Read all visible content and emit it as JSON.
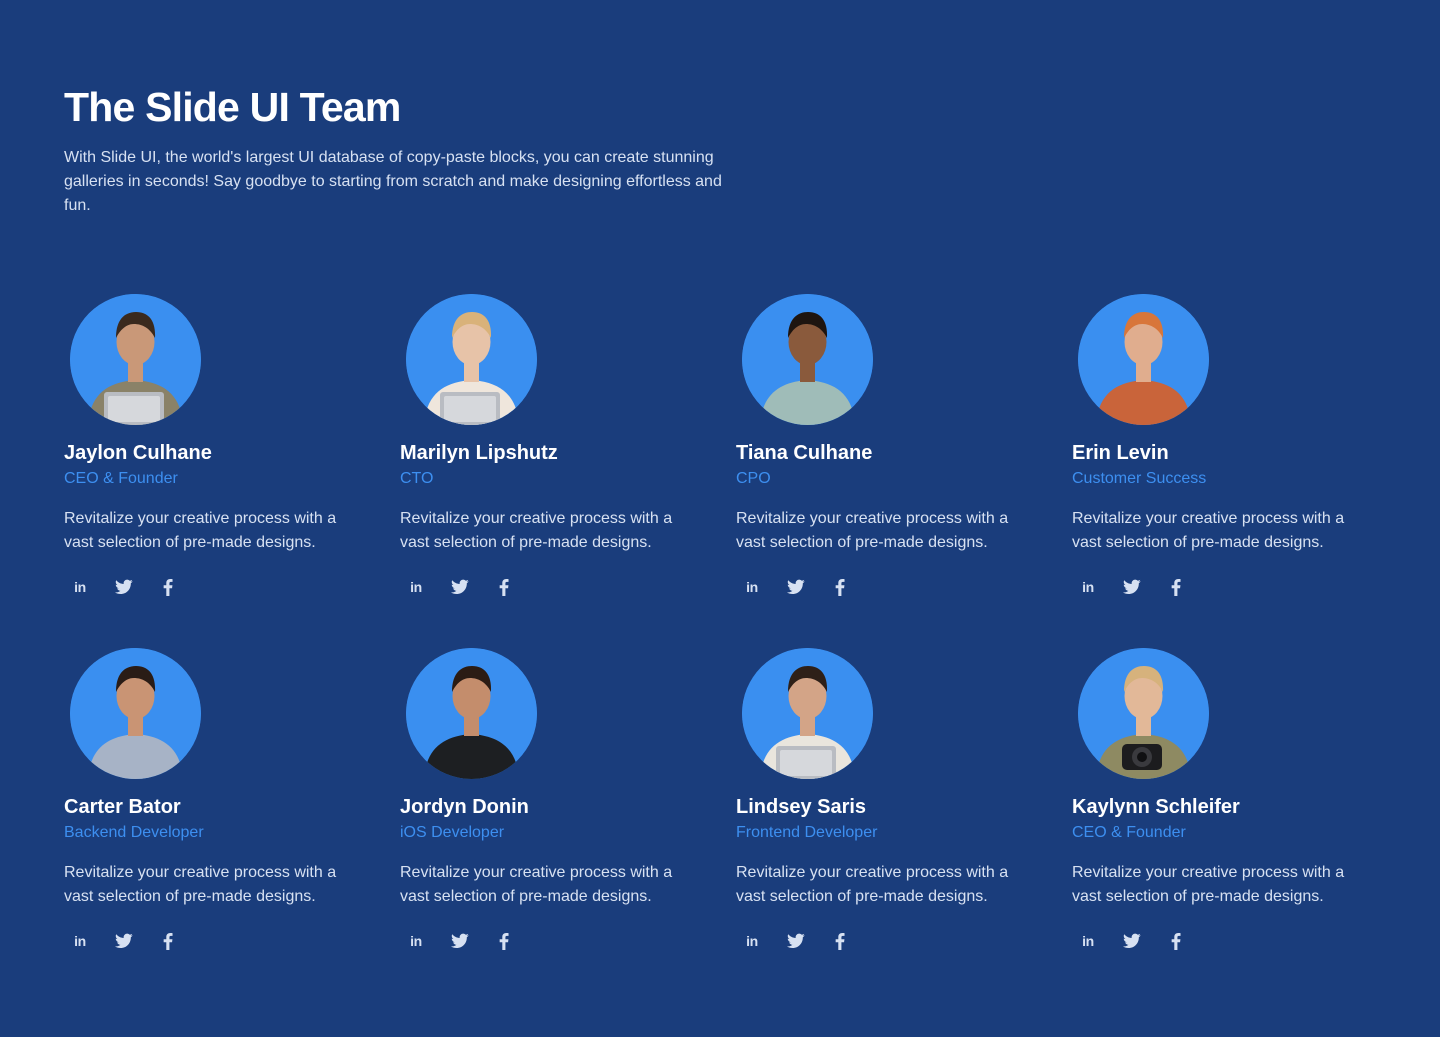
{
  "page": {
    "title": "The Slide UI Team",
    "description": "With Slide UI, the world's largest UI database of copy-paste blocks, you can create stunning galleries in seconds! Say goodbye to starting from scratch and make designing effortless and fun."
  },
  "colors": {
    "background": "#1a3d7c",
    "accent": "#3d8ff0",
    "avatar_bg": "#3a8ff0",
    "text_muted": "#d7e1f2"
  },
  "members": [
    {
      "name": "Jaylon Culhane",
      "role": "CEO & Founder",
      "bio": "Revitalize your creative process with a vast selection of pre-made designs.",
      "social": {
        "linkedin": "in"
      },
      "avatar": {
        "skin": "#c99878",
        "hair": "#3a2a1e",
        "top": "#8a8268",
        "prop": "laptop"
      }
    },
    {
      "name": "Marilyn Lipshutz",
      "role": "CTO",
      "bio": "Revitalize your creative process with a vast selection of pre-made designs.",
      "social": {
        "linkedin": "in"
      },
      "avatar": {
        "skin": "#e7c3a8",
        "hair": "#d9b27a",
        "top": "#efe6dc",
        "prop": "laptop"
      }
    },
    {
      "name": "Tiana Culhane",
      "role": "CPO",
      "bio": "Revitalize your creative process with a vast selection of pre-made designs.",
      "social": {
        "linkedin": "in"
      },
      "avatar": {
        "skin": "#8a5a3c",
        "hair": "#1e1510",
        "top": "#9fbcb8",
        "prop": "none"
      }
    },
    {
      "name": "Erin Levin",
      "role": "Customer Success",
      "bio": "Revitalize your creative process with a vast selection of pre-made designs.",
      "social": {
        "linkedin": "in"
      },
      "avatar": {
        "skin": "#e0ad8e",
        "hair": "#d8763a",
        "top": "#c9643a",
        "prop": "none"
      }
    },
    {
      "name": "Carter Bator",
      "role": "Backend Developer",
      "bio": "Revitalize your creative process with a vast selection of pre-made designs.",
      "social": {
        "linkedin": "in"
      },
      "avatar": {
        "skin": "#c99474",
        "hair": "#2a1c16",
        "top": "#a7b3c6",
        "prop": "none"
      }
    },
    {
      "name": "Jordyn Donin",
      "role": "iOS Developer",
      "bio": "Revitalize your creative process with a vast selection of pre-made designs.",
      "social": {
        "linkedin": "in"
      },
      "avatar": {
        "skin": "#c48d6c",
        "hair": "#2b1c14",
        "top": "#1d1f22",
        "prop": "none"
      }
    },
    {
      "name": "Lindsey Saris",
      "role": "Frontend Developer",
      "bio": "Revitalize your creative process with a vast selection of pre-made designs.",
      "social": {
        "linkedin": "in"
      },
      "avatar": {
        "skin": "#d3a487",
        "hair": "#2e2018",
        "top": "#e9e5dd",
        "prop": "laptop"
      }
    },
    {
      "name": "Kaylynn Schleifer",
      "role": "CEO & Founder",
      "bio": "Revitalize your creative process with a vast selection of pre-made designs.",
      "social": {
        "linkedin": "in"
      },
      "avatar": {
        "skin": "#e2b898",
        "hair": "#d6b27c",
        "top": "#8e8a62",
        "prop": "camera"
      }
    }
  ]
}
